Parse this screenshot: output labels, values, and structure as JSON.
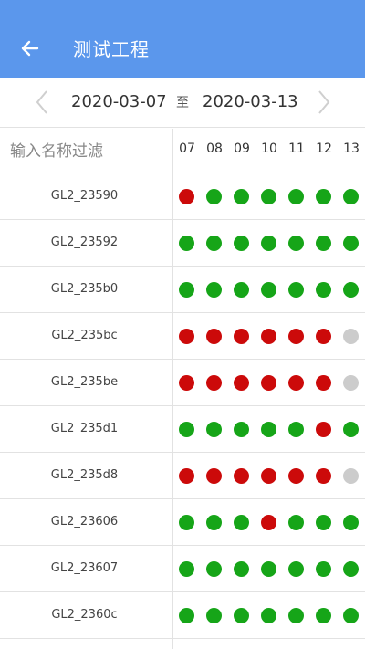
{
  "header": {
    "title": "测试工程",
    "back_icon": "arrow-left-icon"
  },
  "date_range": {
    "start": "2020-03-07",
    "separator": "至",
    "end": "2020-03-13",
    "prev_icon": "chevron-left-icon",
    "next_icon": "chevron-right-icon"
  },
  "filter": {
    "placeholder": "输入名称过滤",
    "value": ""
  },
  "days": [
    "07",
    "08",
    "09",
    "10",
    "11",
    "12",
    "13"
  ],
  "colors": {
    "ok": "#16a518",
    "error": "#cc0a0a",
    "unknown": "#cccccc"
  },
  "rows": [
    {
      "name": "GL2_23590",
      "status": [
        "error",
        "ok",
        "ok",
        "ok",
        "ok",
        "ok",
        "ok"
      ]
    },
    {
      "name": "GL2_23592",
      "status": [
        "ok",
        "ok",
        "ok",
        "ok",
        "ok",
        "ok",
        "ok"
      ]
    },
    {
      "name": "GL2_235b0",
      "status": [
        "ok",
        "ok",
        "ok",
        "ok",
        "ok",
        "ok",
        "ok"
      ]
    },
    {
      "name": "GL2_235bc",
      "status": [
        "error",
        "error",
        "error",
        "error",
        "error",
        "error",
        "unknown"
      ]
    },
    {
      "name": "GL2_235be",
      "status": [
        "error",
        "error",
        "error",
        "error",
        "error",
        "error",
        "unknown"
      ]
    },
    {
      "name": "GL2_235d1",
      "status": [
        "ok",
        "ok",
        "ok",
        "ok",
        "ok",
        "error",
        "ok"
      ]
    },
    {
      "name": "GL2_235d8",
      "status": [
        "error",
        "error",
        "error",
        "error",
        "error",
        "error",
        "unknown"
      ]
    },
    {
      "name": "GL2_23606",
      "status": [
        "ok",
        "ok",
        "ok",
        "error",
        "ok",
        "ok",
        "ok"
      ]
    },
    {
      "name": "GL2_23607",
      "status": [
        "ok",
        "ok",
        "ok",
        "ok",
        "ok",
        "ok",
        "ok"
      ]
    },
    {
      "name": "GL2_2360c",
      "status": [
        "ok",
        "ok",
        "ok",
        "ok",
        "ok",
        "ok",
        "ok"
      ]
    }
  ]
}
